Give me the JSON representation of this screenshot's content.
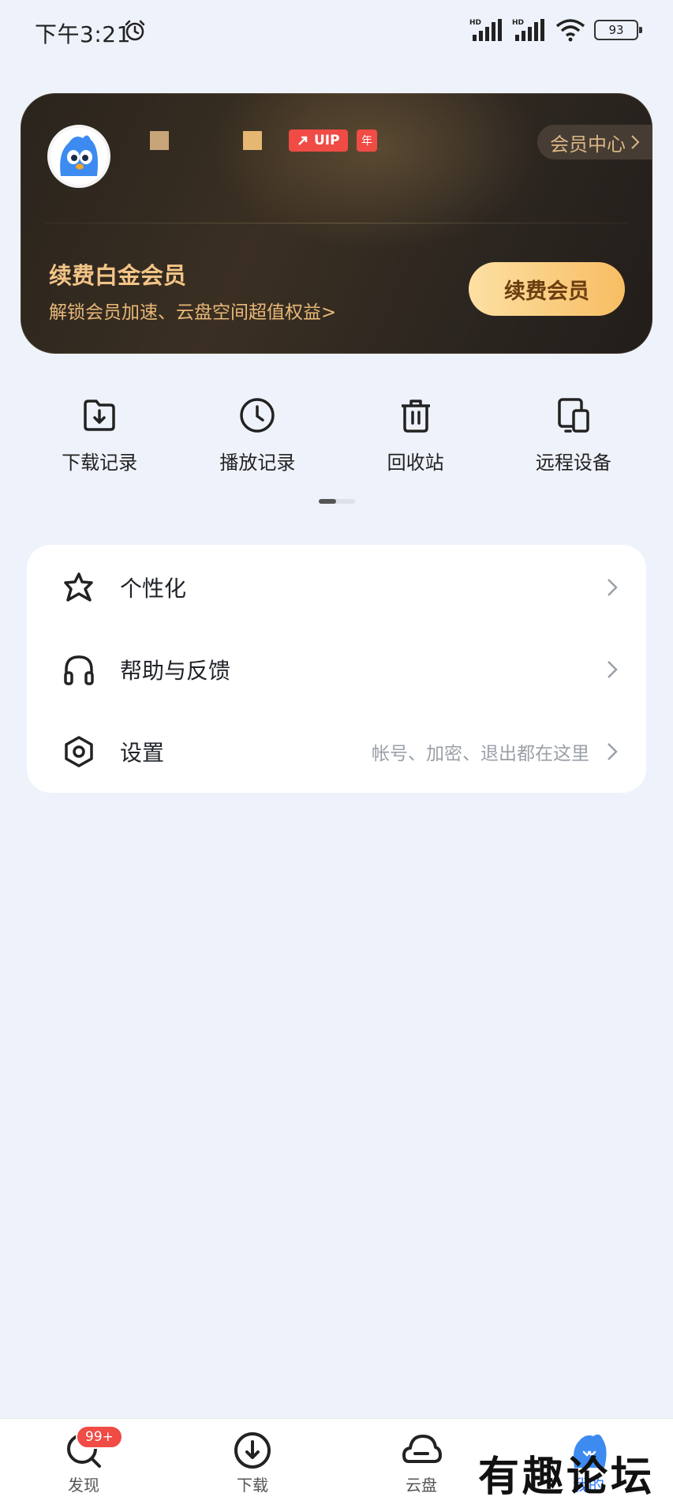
{
  "status_bar": {
    "time": "下午3:21",
    "battery": "93"
  },
  "vip_card": {
    "vip_badge": "UIP",
    "year_badge": "年",
    "member_center": "会员中心",
    "renew_title": "续费白金会员",
    "renew_subtitle": "解锁会员加速、云盘空间超值权益>",
    "renew_button": "续费会员"
  },
  "quick_actions": [
    {
      "label": "下载记录",
      "icon": "download-record-icon"
    },
    {
      "label": "播放记录",
      "icon": "clock-icon"
    },
    {
      "label": "回收站",
      "icon": "trash-icon"
    },
    {
      "label": "远程设备",
      "icon": "devices-icon"
    }
  ],
  "menu": [
    {
      "label": "个性化",
      "icon": "star-icon",
      "hint": ""
    },
    {
      "label": "帮助与反馈",
      "icon": "headphones-icon",
      "hint": ""
    },
    {
      "label": "设置",
      "icon": "settings-icon",
      "hint": "帐号、加密、退出都在这里"
    }
  ],
  "bottom_nav": {
    "badge": "99+",
    "items": [
      {
        "label": "发现",
        "icon": "discover-icon"
      },
      {
        "label": "下载",
        "icon": "download-icon"
      },
      {
        "label": "云盘",
        "icon": "cloud-icon"
      },
      {
        "label": "我的",
        "icon": "profile-icon"
      }
    ]
  },
  "watermark": "有趣论坛",
  "colors": {
    "accent": "#2f7bf6",
    "vip_gold": "#f2c487",
    "badge_red": "#f04b45"
  }
}
